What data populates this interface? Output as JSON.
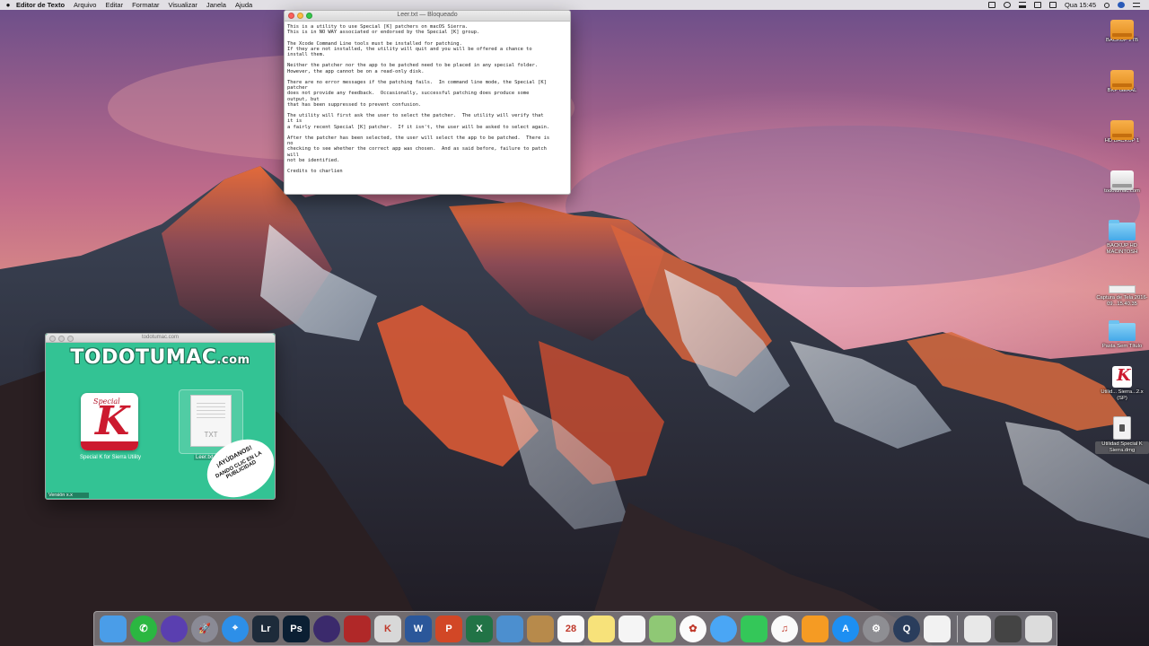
{
  "menubar": {
    "apple_icon": "apple-icon",
    "app_name": "Editor de Texto",
    "menus": [
      "Arquivo",
      "Editar",
      "Formatar",
      "Visualizar",
      "Janela",
      "Ajuda"
    ],
    "clock": "Qua 15:45",
    "status_icons": [
      "screen-mirror-icon",
      "volume-icon",
      "wifi-icon",
      "battery-icon",
      "sync-icon",
      "search-icon",
      "user-avatar-icon",
      "notification-list-icon"
    ]
  },
  "text_window": {
    "title": "Leer.txt — Bloqueado",
    "content": "This is a utility to use Special [K] patchers on macOS Sierra.\nThis is in NO WAY associated or endorsed by the Special [K] group.\n\nThe Xcode Command Line tools must be installed for patching.\nIf they are not installed, the utility will quit and you will be offered a chance to\ninstall them.\n\nNeither the patcher nor the app to be patched need to be placed in any special folder.\nHowever, the app cannot be on a read-only disk.\n\nThere are no error messages if the patching fails.  In command line mode, the Special [K]\npatcher\ndoes not provide any feedback.  Occasionally, successful patching does produce some\noutput, but\nthat has been suppressed to prevent confusion.\n\nThe utility will first ask the user to select the patcher.  The utility will verify that\nit is\na fairly recent Special [K] patcher.  If it isn't, the user will be asked to select again.\n\nAfter the patcher has been selected, the user will select the app to be patched.  There is\nno\nchecking to see whether the correct app was chosen.  And as said before, failure to patch\nwill\nnot be identified.\n\nCredits to charlien"
  },
  "installer_window": {
    "title": "todotumac.com",
    "logo_main": "TODOTUMAC",
    "logo_suffix": ".com",
    "app_icon_special": "Special",
    "app_icon_letter": "K",
    "app_label": "Special K for Sierra Utility",
    "txt_ext": "TXT",
    "txt_label": "Leer.txt",
    "promo_line1": "¡AYÚDANOS!",
    "promo_line2": "DANDO CLIC EN LA PUBLICIDAD",
    "version": "Versión x.x"
  },
  "desktop_icons": [
    {
      "label": "BACKUP 2TB",
      "kind": "drive-orange"
    },
    {
      "label": "BKP GERAL",
      "kind": "drive-orange"
    },
    {
      "label": "HD BACKUP 1",
      "kind": "drive-orange"
    },
    {
      "label": "todotumac.com",
      "kind": "drive-white"
    },
    {
      "label": "BACKUP HD MACINTOSH",
      "kind": "folder"
    },
    {
      "label": "Captura de Tela 2016-09...15.40.35",
      "kind": "screenshot"
    },
    {
      "label": "Pasta Sem Título",
      "kind": "folder"
    },
    {
      "label": "Utilid... Sierra...2.x (SP)",
      "kind": "special-k"
    },
    {
      "label": "Utilidad Special K Sierra.dmg",
      "kind": "dmg"
    }
  ],
  "dock": {
    "items": [
      {
        "name": "finder-icon",
        "text": "",
        "color": "#4a9de8"
      },
      {
        "name": "whatsapp-icon",
        "text": "✆",
        "color": "#2bb741"
      },
      {
        "name": "siri-icon",
        "text": "",
        "color": "#5a3fb0"
      },
      {
        "name": "launchpad-icon",
        "text": "🚀",
        "color": "#8a8a95"
      },
      {
        "name": "safari-icon",
        "text": "⌖",
        "color": "#2d8fe8"
      },
      {
        "name": "lightroom-icon",
        "text": "Lr",
        "color": "#1d2b3a"
      },
      {
        "name": "photoshop-icon",
        "text": "Ps",
        "color": "#0b1f33"
      },
      {
        "name": "colorsync-icon",
        "text": "",
        "color": "#3b2a6c"
      },
      {
        "name": "photo-booth-icon",
        "text": "",
        "color": "#b02828"
      },
      {
        "name": "special-k-icon",
        "text": "K",
        "color": "#d8d8d8"
      },
      {
        "name": "word-icon",
        "text": "W",
        "color": "#2b579a"
      },
      {
        "name": "powerpoint-icon",
        "text": "P",
        "color": "#d24726"
      },
      {
        "name": "excel-icon",
        "text": "X",
        "color": "#217346"
      },
      {
        "name": "preview-icon",
        "text": "",
        "color": "#4c8fcf"
      },
      {
        "name": "contacts-icon",
        "text": "",
        "color": "#b78a4b"
      },
      {
        "name": "calendar-icon",
        "text": "28",
        "color": "#fafafa"
      },
      {
        "name": "notes-icon",
        "text": "",
        "color": "#f7e27a"
      },
      {
        "name": "reminders-icon",
        "text": "",
        "color": "#f5f5f5"
      },
      {
        "name": "maps-icon",
        "text": "",
        "color": "#8fc875"
      },
      {
        "name": "photos-icon",
        "text": "✿",
        "color": "#fbfbfb"
      },
      {
        "name": "messages-icon",
        "text": "",
        "color": "#4aa6f5"
      },
      {
        "name": "facetime-icon",
        "text": "",
        "color": "#34c759"
      },
      {
        "name": "itunes-icon",
        "text": "♫",
        "color": "#fafafa"
      },
      {
        "name": "ibooks-icon",
        "text": "",
        "color": "#f59b23"
      },
      {
        "name": "app-store-icon",
        "text": "A",
        "color": "#1d8ff2"
      },
      {
        "name": "system-preferences-icon",
        "text": "⚙",
        "color": "#8e8e93"
      },
      {
        "name": "quicktime-icon",
        "text": "Q",
        "color": "#2a3d5c"
      },
      {
        "name": "textedit-icon",
        "text": "",
        "color": "#f2f2f2"
      },
      {
        "name": "document-icon",
        "text": "",
        "color": "#e8e8e8"
      },
      {
        "name": "video-thumbnail-icon",
        "text": "",
        "color": "#444"
      },
      {
        "name": "trash-icon",
        "text": "",
        "color": "#dcdcdc"
      }
    ],
    "separator_after": 28
  }
}
